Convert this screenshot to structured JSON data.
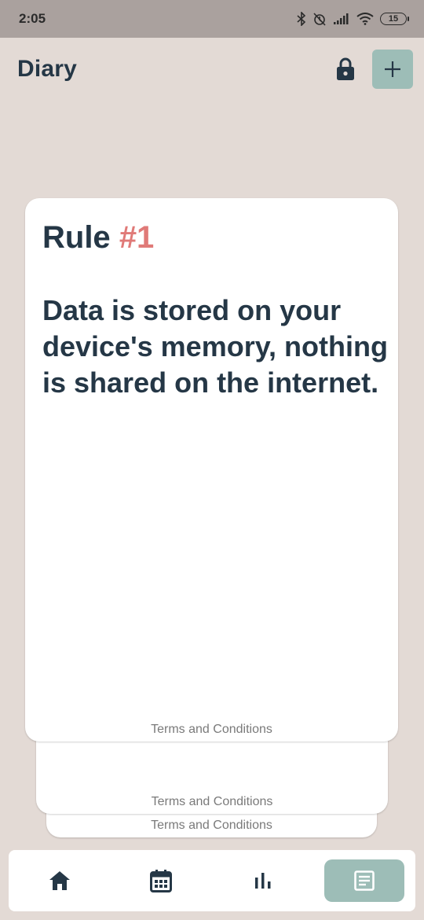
{
  "status_bar": {
    "time": "2:05",
    "battery": "15",
    "icons": [
      "bluetooth-icon",
      "alarm-off-icon",
      "signal-icon",
      "wifi-icon",
      "battery-icon"
    ]
  },
  "header": {
    "title": "Diary",
    "icons": [
      "lock-icon",
      "plus-icon"
    ]
  },
  "card": {
    "rule_word": "Rule",
    "rule_number": "#1",
    "text": "Data is stored on your device's memory, nothing is shared on the internet.",
    "footer": "Terms and Conditions"
  },
  "stack": {
    "footer_1": "Terms and Conditions",
    "footer_2": "Terms and Conditions"
  },
  "nav": {
    "items": [
      {
        "icon": "home-icon",
        "active": false
      },
      {
        "icon": "calendar-icon",
        "active": false
      },
      {
        "icon": "bar-chart-icon",
        "active": false
      },
      {
        "icon": "notes-icon",
        "active": true
      }
    ]
  },
  "colors": {
    "background": "#e3dad5",
    "status_bar": "#aaa19e",
    "primary_text": "#253746",
    "accent": "#e07a78",
    "button": "#9dbdb7"
  }
}
